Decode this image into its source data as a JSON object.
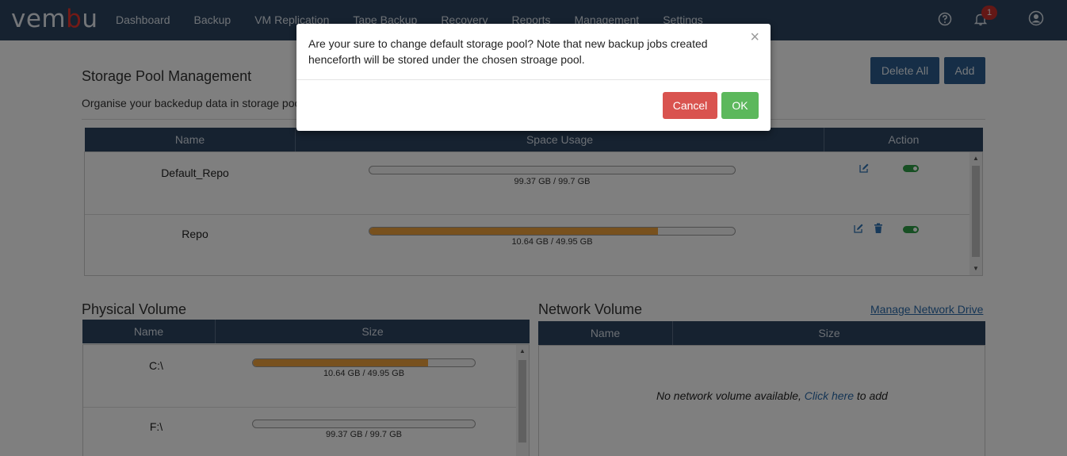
{
  "app": {
    "logo_text": "vem",
    "logo_accent": "b",
    "logo_tail": "u"
  },
  "nav": [
    "Dashboard",
    "Backup",
    "VM Replication",
    "Tape Backup",
    "Recovery",
    "Reports",
    "Management",
    "Settings"
  ],
  "header": {
    "notification_count": "1",
    "icons": [
      "help-icon",
      "bell-icon",
      "user-icon"
    ]
  },
  "page": {
    "title": "Storage Pool Management",
    "subtitle": "Organise your backedup data in storage poo",
    "delete_all_label": "Delete All",
    "add_label": "Add"
  },
  "pool_table": {
    "columns": [
      "Name",
      "Space Usage",
      "Action"
    ],
    "rows": [
      {
        "name": "Default_Repo",
        "usage_text": "99.37 GB / 99.7 GB",
        "fill_percent": 0
      },
      {
        "name": "Repo",
        "usage_text": "10.64 GB / 49.95 GB",
        "fill_percent": 79
      }
    ]
  },
  "physical": {
    "title": "Physical Volume",
    "columns": [
      "Name",
      "Size"
    ],
    "rows": [
      {
        "name": "C:\\",
        "usage_text": "10.64 GB / 49.95 GB",
        "fill_percent": 79
      },
      {
        "name": "F:\\",
        "usage_text": "99.37 GB / 99.7 GB",
        "fill_percent": 0
      }
    ]
  },
  "network": {
    "title": "Network Volume",
    "manage_link": "Manage Network Drive",
    "columns": [
      "Name",
      "Size"
    ],
    "empty_prefix": "No network volume available, ",
    "empty_link": "Click here",
    "empty_suffix": " to add"
  },
  "modal": {
    "message": "Are your sure to change default storage pool? Note that new backup jobs created henceforth will be stored under the chosen stroage pool.",
    "close_symbol": "×",
    "cancel_label": "Cancel",
    "ok_label": "OK"
  },
  "colors": {
    "nav_bg": "#2d4461",
    "accent_blue": "#2d5d8f",
    "bar_fill": "#f0a23c",
    "cancel": "#d9534f",
    "ok": "#5cb85c",
    "toggle_on": "#2e9e47"
  }
}
